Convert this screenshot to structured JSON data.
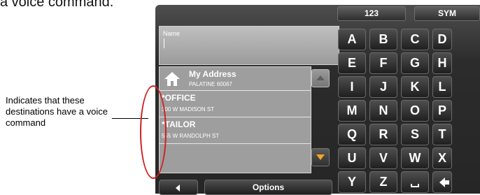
{
  "document": {
    "text_fragment": "a voice command."
  },
  "callout": {
    "text": "Indicates that these destinations have a voice command",
    "oval_color": "#d12020"
  },
  "name_field": {
    "placeholder": "Name",
    "value": ""
  },
  "destinations": [
    {
      "name": "My Address",
      "address": "PALATINE 60067",
      "icon": "home-icon"
    },
    {
      "name": "*OFFICE",
      "address": "300 W MADISON ST"
    },
    {
      "name": "*TAILOR",
      "address": "555 W RANDOLPH ST"
    }
  ],
  "scroll": {
    "up_icon": "triangle-up-icon",
    "down_icon": "triangle-down-icon",
    "down_color": "#f5a623"
  },
  "keyboard": {
    "tabs": [
      "123",
      "SYM"
    ],
    "rows": [
      [
        "A",
        "B",
        "C",
        "D"
      ],
      [
        "E",
        "F",
        "G",
        "H"
      ],
      [
        "I",
        "J",
        "K",
        "L"
      ],
      [
        "M",
        "N",
        "O",
        "P"
      ],
      [
        "Q",
        "R",
        "S",
        "T"
      ],
      [
        "U",
        "V",
        "W",
        "X"
      ],
      [
        "Y",
        "Z"
      ]
    ],
    "space_icon": "space-icon",
    "backspace_icon": "backspace-icon"
  },
  "bottom_bar": {
    "back_icon": "back-arrow-icon",
    "options_label": "Options"
  }
}
